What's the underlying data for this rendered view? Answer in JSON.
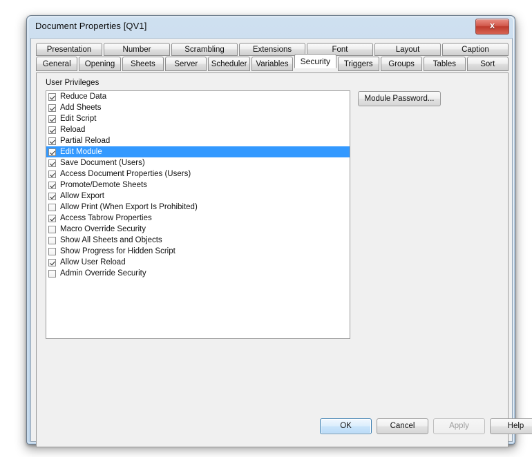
{
  "window": {
    "title": "Document Properties [QV1]",
    "close_label": "x",
    "accent_blue": "#3399ff",
    "titlebar_color": "#bed5ea"
  },
  "tabs": {
    "row1": [
      {
        "label": "Presentation",
        "active": false
      },
      {
        "label": "Number",
        "active": false
      },
      {
        "label": "Scrambling",
        "active": false
      },
      {
        "label": "Extensions",
        "active": false
      },
      {
        "label": "Font",
        "active": false
      },
      {
        "label": "Layout",
        "active": false
      },
      {
        "label": "Caption",
        "active": false
      }
    ],
    "row2": [
      {
        "label": "General",
        "active": false
      },
      {
        "label": "Opening",
        "active": false
      },
      {
        "label": "Sheets",
        "active": false
      },
      {
        "label": "Server",
        "active": false
      },
      {
        "label": "Scheduler",
        "active": false
      },
      {
        "label": "Variables",
        "active": false
      },
      {
        "label": "Security",
        "active": true
      },
      {
        "label": "Triggers",
        "active": false
      },
      {
        "label": "Groups",
        "active": false
      },
      {
        "label": "Tables",
        "active": false
      },
      {
        "label": "Sort",
        "active": false
      }
    ]
  },
  "security_tab": {
    "group_label": "User Privileges",
    "module_password_label": "Module Password...",
    "privileges": [
      {
        "label": "Reduce Data",
        "checked": true,
        "selected": false
      },
      {
        "label": "Add Sheets",
        "checked": true,
        "selected": false
      },
      {
        "label": "Edit Script",
        "checked": true,
        "selected": false
      },
      {
        "label": "Reload",
        "checked": true,
        "selected": false
      },
      {
        "label": "Partial Reload",
        "checked": true,
        "selected": false
      },
      {
        "label": "Edit Module",
        "checked": true,
        "selected": true
      },
      {
        "label": "Save Document (Users)",
        "checked": true,
        "selected": false
      },
      {
        "label": "Access Document Properties (Users)",
        "checked": true,
        "selected": false
      },
      {
        "label": "Promote/Demote Sheets",
        "checked": true,
        "selected": false
      },
      {
        "label": "Allow Export",
        "checked": true,
        "selected": false
      },
      {
        "label": "Allow Print (When Export Is Prohibited)",
        "checked": false,
        "selected": false
      },
      {
        "label": "Access Tabrow Properties",
        "checked": true,
        "selected": false
      },
      {
        "label": "Macro Override Security",
        "checked": false,
        "selected": false
      },
      {
        "label": "Show All Sheets and Objects",
        "checked": false,
        "selected": false
      },
      {
        "label": "Show Progress for Hidden Script",
        "checked": false,
        "selected": false
      },
      {
        "label": "Allow User Reload",
        "checked": true,
        "selected": false
      },
      {
        "label": "Admin Override Security",
        "checked": false,
        "selected": false
      }
    ]
  },
  "buttons": {
    "ok": "OK",
    "cancel": "Cancel",
    "apply": "Apply",
    "help": "Help"
  }
}
